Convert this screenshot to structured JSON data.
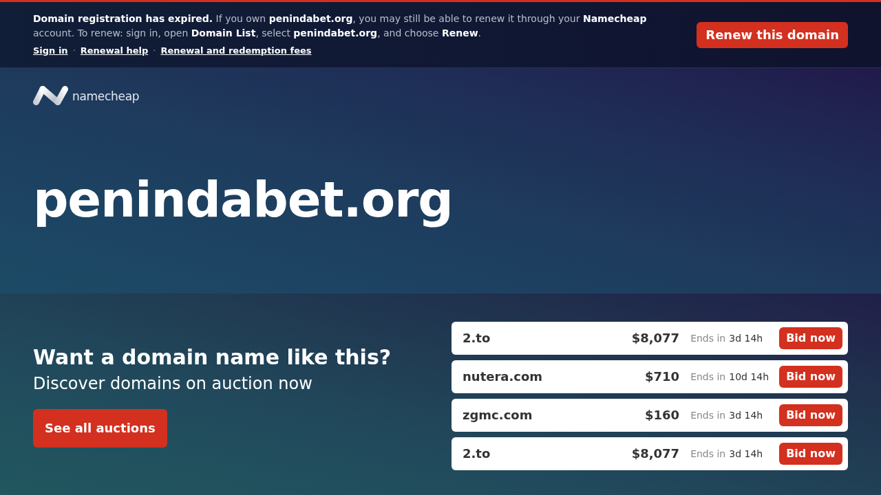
{
  "notice": {
    "text": "**Domain registration has expired.** If you own **penindabet.org**, you may still be able to renew it through your **Namecheap** account. To renew: sign in, open **Domain List**, select **penindabet.org**, and choose **Renew**.",
    "links": [
      {
        "label": "Sign in"
      },
      {
        "label": "Renewal help"
      },
      {
        "label": "Renewal and redemption fees"
      }
    ],
    "separators": [
      "·",
      "·"
    ],
    "button": "Renew this domain"
  },
  "logo": {
    "text": "namecheap"
  },
  "domain": "penindabet.org",
  "auctions": {
    "heading": "Want a domain name like this?",
    "subtitle": "Discover domains on auction now",
    "button": "See all auctions",
    "rows": [
      {
        "domain": "2.to",
        "price": "$8,077",
        "ends_label": "Ends in",
        "ends_time": "3d 14h",
        "action": "Bid now"
      },
      {
        "domain": "nutera.com",
        "price": "$710",
        "ends_label": "Ends in",
        "ends_time": "10d 14h",
        "action": "Bid now"
      },
      {
        "domain": "zgmc.com",
        "price": "$160",
        "ends_label": "Ends in",
        "ends_time": "3d 14h",
        "action": "Bid now"
      },
      {
        "domain": "2.to",
        "price": "$8,077",
        "ends_label": "Ends in",
        "ends_time": "3d 14h",
        "action": "Bid now"
      }
    ]
  }
}
